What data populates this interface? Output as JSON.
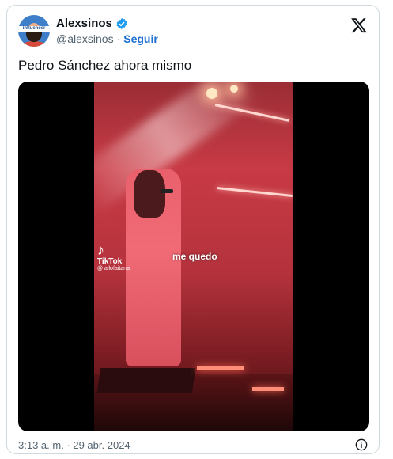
{
  "author": {
    "display_name": "Alexsinos",
    "handle": "@alexsinos",
    "verified": true,
    "avatar_banner_text": "influencer"
  },
  "actions": {
    "follow_label": "Seguir",
    "separator": "·"
  },
  "tweet": {
    "text": "Pedro Sánchez ahora mismo",
    "timestamp": "3:13 a. m. · 29 abr. 2024"
  },
  "video": {
    "caption": "me quedo",
    "watermark_brand": "TikTok",
    "watermark_user": "@ allofaitana"
  },
  "icons": {
    "platform": "x-logo-icon",
    "verified": "verified-badge-icon",
    "info": "info-icon",
    "watermark": "tiktok-icon"
  },
  "colors": {
    "follow": "#1d6fd1",
    "verified": "#1d9bf0",
    "text": "#0f1419",
    "muted": "#536471"
  }
}
